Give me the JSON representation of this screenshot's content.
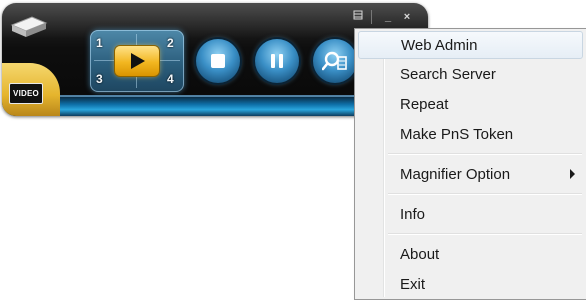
{
  "player": {
    "video_badge": "VIDEO",
    "grid_labels": [
      "1",
      "2",
      "3",
      "4"
    ],
    "window_controls": {
      "menu_icon": "window-menu-icon",
      "minimize": "_",
      "close": "×"
    },
    "buttons": {
      "play": "play-icon",
      "stop": "stop-icon",
      "pause": "pause-icon",
      "snapshot": "magnifier-snapshot-icon"
    },
    "colors": {
      "accent_blue": "#2aa6dd",
      "accent_gold": "#f2b620"
    }
  },
  "context_menu": {
    "items": [
      {
        "label": "Web Admin"
      },
      {
        "label": "Search Server"
      },
      {
        "label": "Repeat"
      },
      {
        "label": "Make PnS Token"
      },
      {
        "label": "Magnifier Option",
        "submenu_icon": "chevron-right-icon"
      },
      {
        "label": "Info"
      },
      {
        "label": "About"
      },
      {
        "label": "Exit"
      }
    ]
  }
}
